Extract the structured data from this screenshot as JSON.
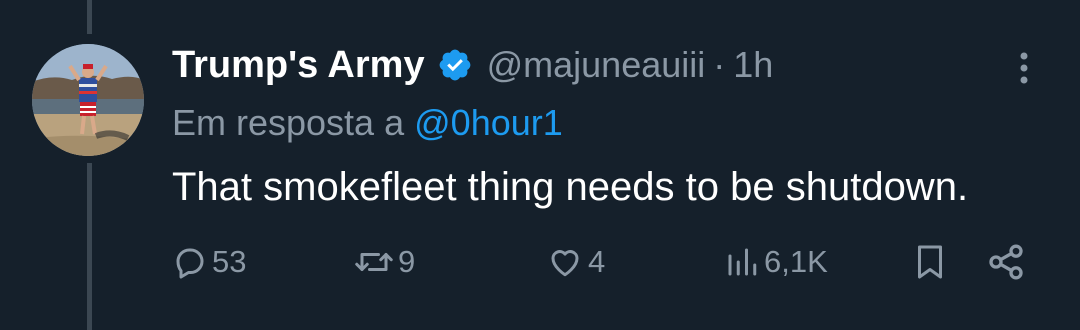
{
  "tweet": {
    "author_name": "Trump's Army",
    "handle": "@majuneauiii",
    "separator": "·",
    "time": "1h",
    "reply_prefix": "Em resposta a",
    "reply_to": "@0hour1",
    "text": "That smokefleet thing needs to be shutdown.",
    "verified": true
  },
  "actions": {
    "replies": "53",
    "retweets": "9",
    "likes": "4",
    "views": "6,1K"
  },
  "icons": {
    "verified": "verified-badge-icon",
    "more": "more-vertical-icon",
    "reply": "reply-bubble-icon",
    "retweet": "retweet-icon",
    "like": "heart-icon",
    "views": "views-bar-chart-icon",
    "bookmark": "bookmark-icon",
    "share": "share-icon"
  },
  "colors": {
    "background": "#15202b",
    "primary_text": "#ffffff",
    "secondary_text": "#8b98a5",
    "accent": "#1d9bf0",
    "thread_line": "#3b4752"
  }
}
